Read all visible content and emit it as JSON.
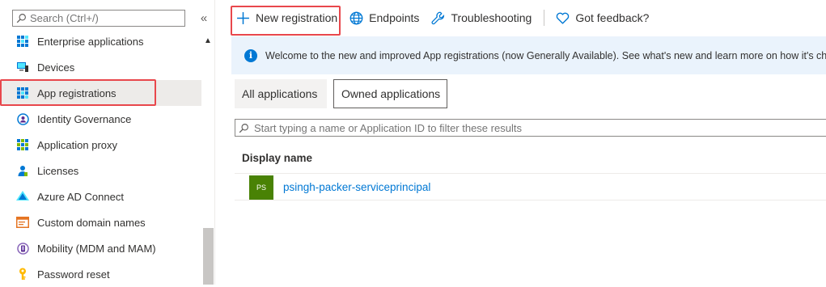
{
  "sidebar": {
    "search_placeholder": "Search (Ctrl+/)",
    "collapse_glyph": "«",
    "scroll_up_glyph": "▲",
    "items": [
      {
        "label": "Enterprise applications",
        "icon": "enterprise-apps-icon"
      },
      {
        "label": "Devices",
        "icon": "devices-icon"
      },
      {
        "label": "App registrations",
        "icon": "app-registrations-icon",
        "selected": true
      },
      {
        "label": "Identity Governance",
        "icon": "identity-governance-icon"
      },
      {
        "label": "Application proxy",
        "icon": "application-proxy-icon"
      },
      {
        "label": "Licenses",
        "icon": "licenses-icon"
      },
      {
        "label": "Azure AD Connect",
        "icon": "azure-ad-connect-icon"
      },
      {
        "label": "Custom domain names",
        "icon": "custom-domain-icon"
      },
      {
        "label": "Mobility (MDM and MAM)",
        "icon": "mobility-icon"
      },
      {
        "label": "Password reset",
        "icon": "password-reset-icon"
      }
    ]
  },
  "toolbar": {
    "new_registration": "New registration",
    "endpoints": "Endpoints",
    "troubleshooting": "Troubleshooting",
    "feedback": "Got feedback?"
  },
  "banner": {
    "info_glyph": "i",
    "text": "Welcome to the new and improved App registrations (now Generally Available). See what's new and learn more on how it's changed"
  },
  "tabs": {
    "all": "All applications",
    "owned": "Owned applications"
  },
  "filter": {
    "placeholder": "Start typing a name or Application ID to filter these results"
  },
  "table": {
    "column_display_name": "Display name",
    "rows": [
      {
        "initials": "PS",
        "name": "psingh-packer-serviceprincipal"
      }
    ]
  },
  "colors": {
    "accent": "#0078d4",
    "highlight": "#e8474c",
    "avatar": "#498205",
    "banner_bg": "#eaf3fc",
    "selected_bg": "#edebe9"
  }
}
